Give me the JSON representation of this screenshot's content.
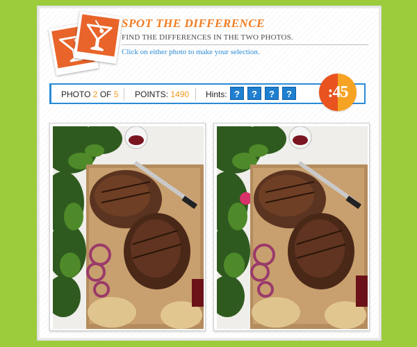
{
  "header": {
    "title": "SPOT THE DIFFERENCE",
    "subtitle": "FIND THE DIFFERENCES IN THE TWO PHOTOS.",
    "instruction": "Click on either photo to make your selection."
  },
  "status": {
    "photo_label": "PHOTO",
    "photo_current": "2",
    "photo_of": "OF",
    "photo_total": "5",
    "points_label": "POINTS:",
    "points_value": "1490",
    "hints_label": "Hints:",
    "hint_symbol": "?",
    "hints_remaining": 4,
    "timer": ":45"
  },
  "photos": {
    "left_icon": "photo-steak-left",
    "right_icon": "photo-steak-right"
  },
  "colors": {
    "background": "#9ccc3c",
    "accent_orange": "#f07c22",
    "accent_blue": "#2a8ad6",
    "number_orange": "#f29a1e"
  }
}
